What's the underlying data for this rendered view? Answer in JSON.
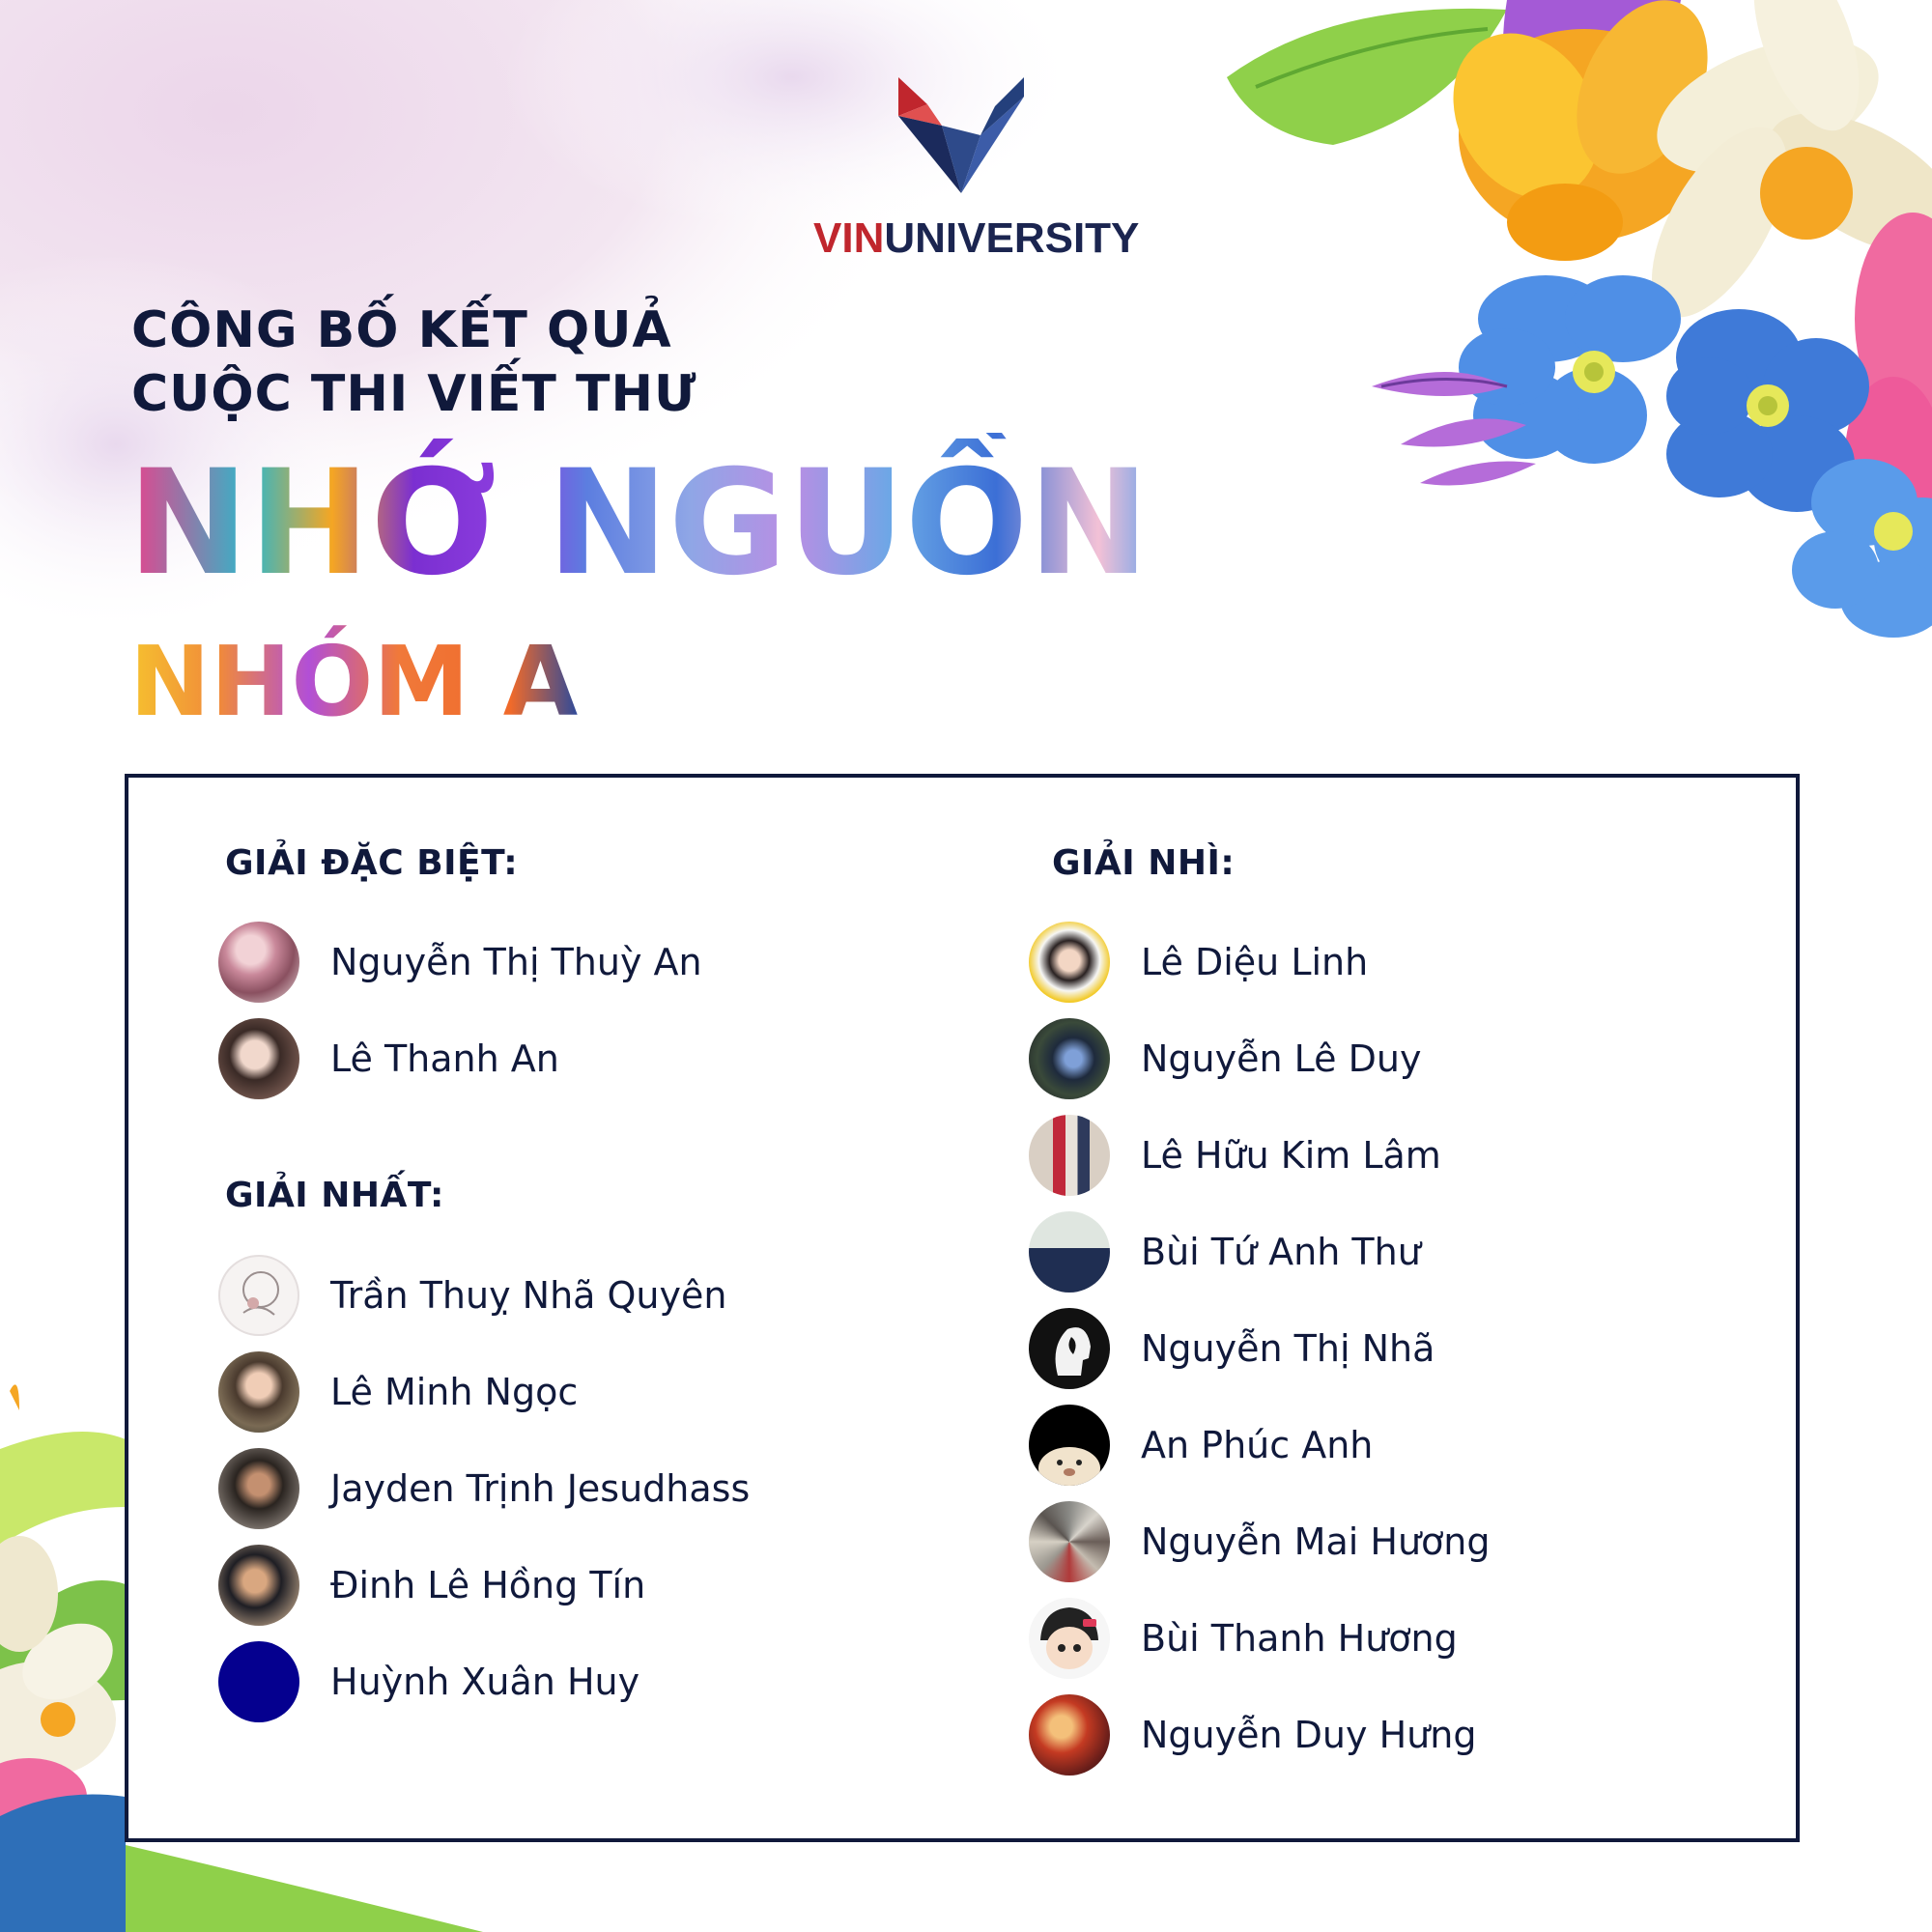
{
  "brand": {
    "vin": "VIN",
    "university": "UNIVERSITY"
  },
  "title": {
    "line1": "CÔNG BỐ KẾT QUẢ",
    "line2": "CUỘC THI VIẾT THƯ",
    "contest": "NHỚ NGUỒN",
    "group": "NHÓM A"
  },
  "colors": {
    "navy": "#10193b",
    "brand_red": "#c0262d"
  },
  "awards": {
    "special": {
      "label": "GIẢI ĐẶC BIỆT:",
      "people": [
        {
          "name": "Nguyễn Thị Thuỳ An",
          "avatar": "photo-avatar"
        },
        {
          "name": "Lê Thanh An",
          "avatar": "photo-avatar"
        }
      ]
    },
    "first": {
      "label": "GIẢI NHẤT:",
      "people": [
        {
          "name": "Trần Thuỵ Nhã Quyên",
          "avatar": "sketch-avatar"
        },
        {
          "name": "Lê Minh Ngọc",
          "avatar": "photo-avatar"
        },
        {
          "name": "Jayden Trịnh Jesudhass",
          "avatar": "photo-avatar"
        },
        {
          "name": "Đinh Lê Hồng Tín",
          "avatar": "photo-avatar"
        },
        {
          "name": "Huỳnh Xuân Huy",
          "avatar": "solid-blue-avatar"
        }
      ]
    },
    "second": {
      "label": "GIẢI NHÌ:",
      "people": [
        {
          "name": "Lê Diệu Linh",
          "avatar": "photo-avatar"
        },
        {
          "name": "Nguyễn Lê Duy",
          "avatar": "photo-avatar"
        },
        {
          "name": "Lê Hữu Kim Lâm",
          "avatar": "photo-avatar"
        },
        {
          "name": "Bùi Tứ Anh Thư",
          "avatar": "photo-avatar"
        },
        {
          "name": "Nguyễn Thị Nhã",
          "avatar": "head-illustration-avatar"
        },
        {
          "name": "An Phúc Anh",
          "avatar": "cartoon-avatar"
        },
        {
          "name": "Nguyễn Mai Hương",
          "avatar": "collage-avatar"
        },
        {
          "name": "Bùi Thanh Hương",
          "avatar": "cartoon-avatar"
        },
        {
          "name": "Nguyễn Duy Hưng",
          "avatar": "photo-avatar"
        }
      ]
    }
  }
}
